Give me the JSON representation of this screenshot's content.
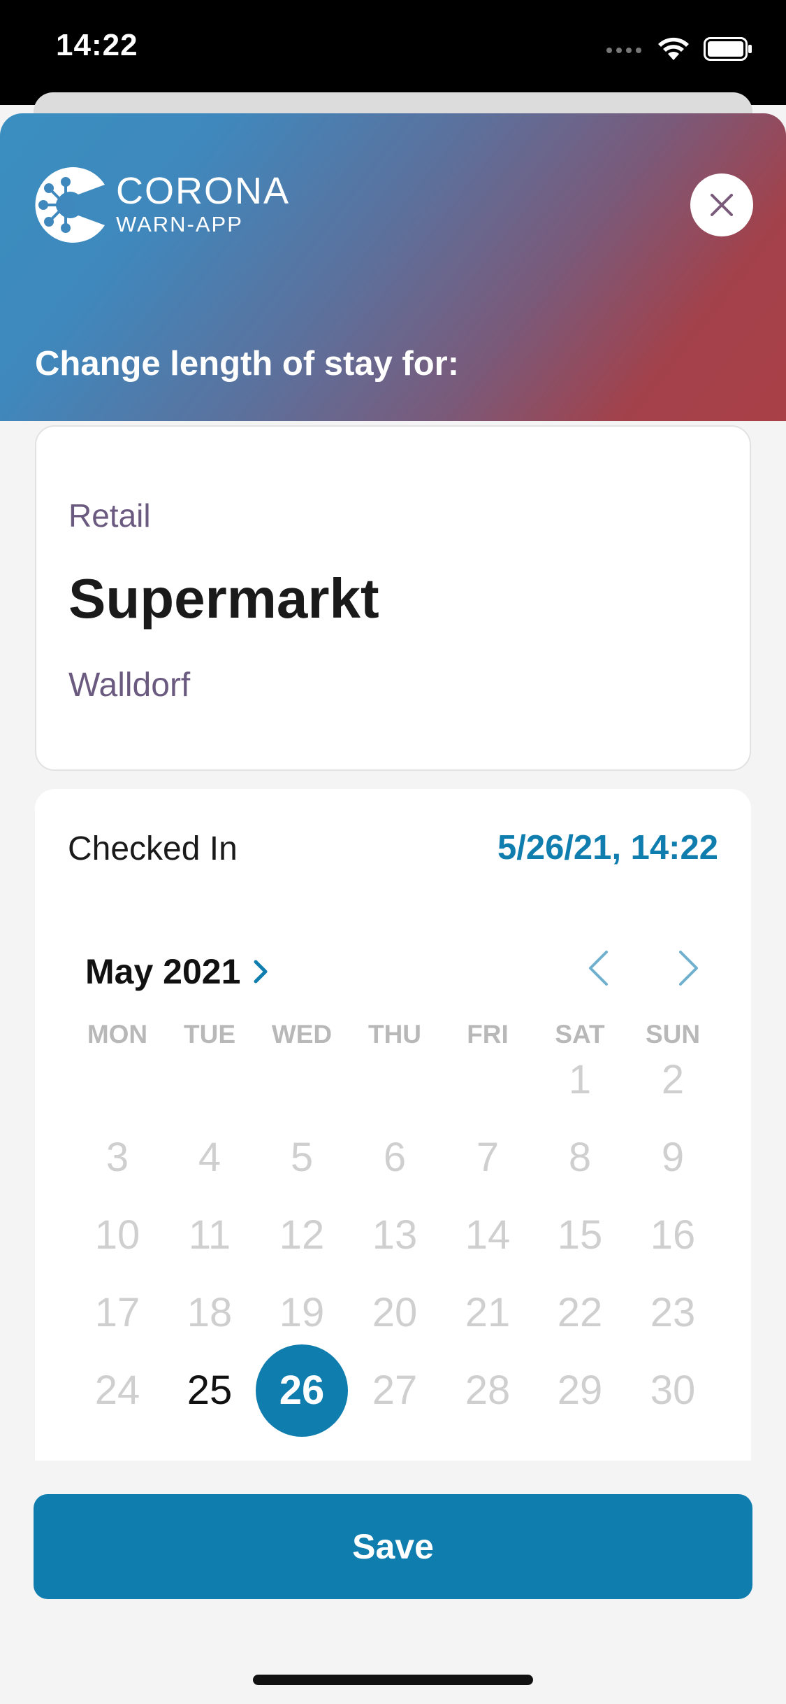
{
  "status_bar": {
    "time": "14:22"
  },
  "header": {
    "logo_line1": "CORONA",
    "logo_line2": "WARN-APP",
    "title": "Change length of stay for:"
  },
  "location": {
    "type": "Retail",
    "name": "Supermarkt",
    "address": "Walldorf"
  },
  "checkin": {
    "label": "Checked In",
    "value": "5/26/21, 14:22"
  },
  "calendar": {
    "month_label": "May 2021",
    "weekdays": [
      "MON",
      "TUE",
      "WED",
      "THU",
      "FRI",
      "SAT",
      "SUN"
    ],
    "weeks": [
      [
        "",
        "",
        "",
        "",
        "",
        "1",
        "2"
      ],
      [
        "3",
        "4",
        "5",
        "6",
        "7",
        "8",
        "9"
      ],
      [
        "10",
        "11",
        "12",
        "13",
        "14",
        "15",
        "16"
      ],
      [
        "17",
        "18",
        "19",
        "20",
        "21",
        "22",
        "23"
      ],
      [
        "24",
        "25",
        "26",
        "27",
        "28",
        "29",
        "30"
      ]
    ],
    "enabled_days": [
      "25",
      "26"
    ],
    "selected_day": "26",
    "accent_color": "#0f7dae"
  },
  "save_label": "Save"
}
